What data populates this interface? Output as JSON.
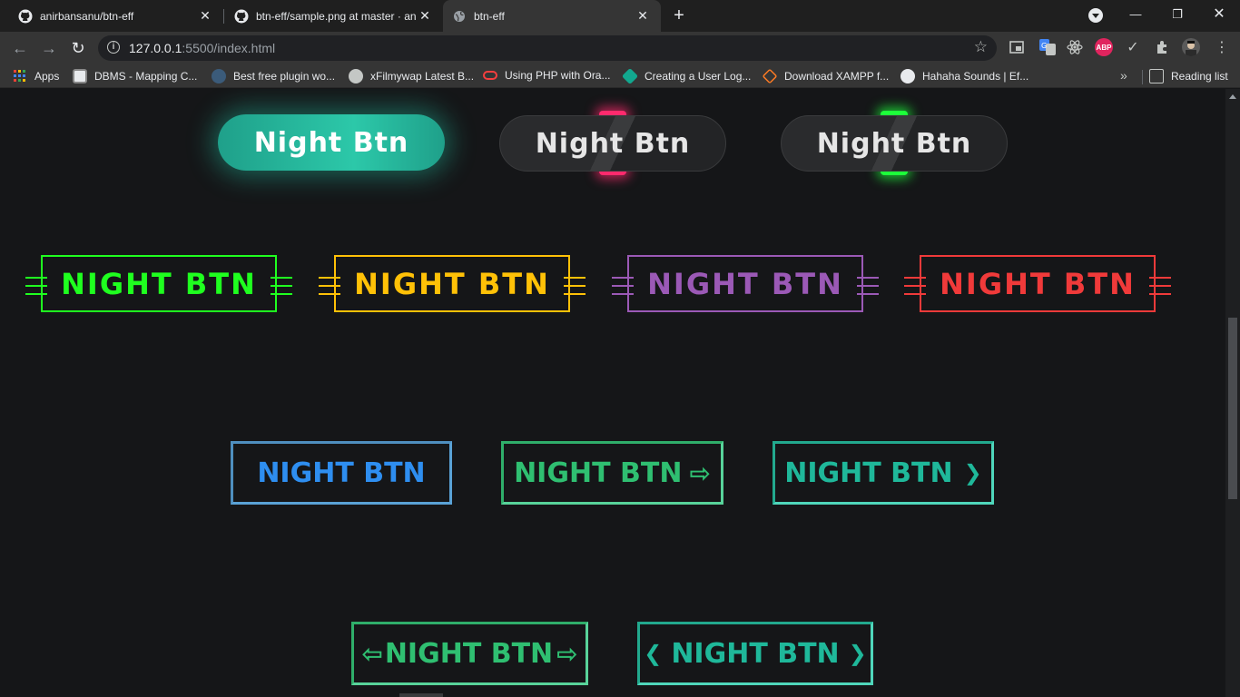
{
  "browser": {
    "tabs": [
      {
        "title": "anirbansanu/btn-eff",
        "icon": "github-icon"
      },
      {
        "title": "btn-eff/sample.png at master · anirbansanu/btn-eff",
        "icon": "github-icon"
      },
      {
        "title": "btn-eff",
        "icon": "globe-icon"
      }
    ],
    "url_host": "127.0.0.1",
    "url_rest": ":5500/index.html",
    "bookmarks": [
      {
        "label": "Apps",
        "icon": "apps-grid-icon"
      },
      {
        "label": "DBMS - Mapping C...",
        "icon": "site-icon"
      },
      {
        "label": "Best free plugin wo...",
        "icon": "wordpress-icon"
      },
      {
        "label": "xFilmywap Latest B...",
        "icon": "globe-icon"
      },
      {
        "label": "Using PHP with Ora...",
        "icon": "oracle-icon"
      },
      {
        "label": "Creating a User Log...",
        "icon": "site-icon"
      },
      {
        "label": "Download XAMPP f...",
        "icon": "xampp-icon"
      },
      {
        "label": "Hahaha Sounds | Ef...",
        "icon": "site-icon"
      }
    ],
    "bookmarks_more": "»",
    "reading_list": "Reading list",
    "extensions": {
      "abp": "ABP"
    }
  },
  "page": {
    "row1": [
      {
        "label": "Night Btn",
        "style": "teal-glow"
      },
      {
        "label": "Night Btn",
        "style": "pink-split"
      },
      {
        "label": "Night Btn",
        "style": "green-split"
      }
    ],
    "row2": [
      {
        "label": "NIGHT BTN",
        "color": "#1fff1f"
      },
      {
        "label": "NIGHT BTN",
        "color": "#ffc107"
      },
      {
        "label": "NIGHT BTN",
        "color": "#9b59b6"
      },
      {
        "label": "NIGHT BTN",
        "color": "#f03a3a"
      }
    ],
    "row3": [
      {
        "label": "NIGHT BTN",
        "suffix": ""
      },
      {
        "label": "NIGHT BTN",
        "suffix": "⇨"
      },
      {
        "label": "NIGHT BTN",
        "suffix": "❯"
      }
    ],
    "row4": [
      {
        "prefix": "⇦",
        "label": "NIGHT BTN",
        "suffix": "⇨"
      },
      {
        "prefix": "❮",
        "label": "NIGHT BTN",
        "suffix": "❯"
      }
    ]
  },
  "colors": {
    "teal": "#22c4a3",
    "blue": "#2e8ef0",
    "green": "#2fbf71",
    "seagreen": "#1fb89a"
  }
}
